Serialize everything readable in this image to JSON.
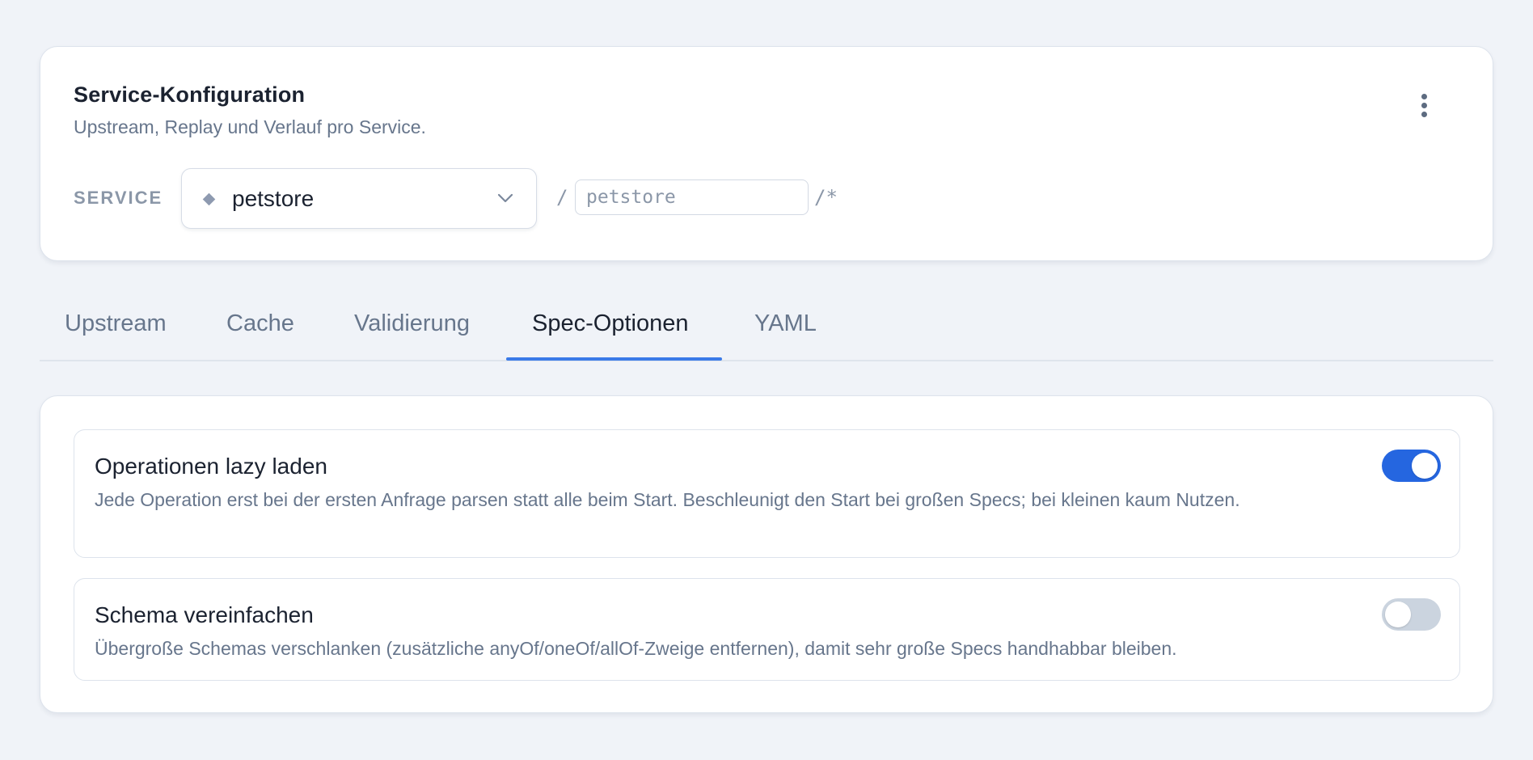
{
  "header": {
    "title": "Service-Konfiguration",
    "subtitle": "Upstream, Replay und Verlauf pro Service.",
    "menu_icon": "more-vertical-icon"
  },
  "service": {
    "label": "SERVICE",
    "selected": "petstore",
    "selected_icon": "diamond-icon",
    "dropdown_icon": "chevron-down-icon",
    "path_prefix": "/",
    "path_placeholder": "petstore",
    "path_suffix": "/*"
  },
  "tabs": [
    {
      "label": "Upstream",
      "active": false
    },
    {
      "label": "Cache",
      "active": false
    },
    {
      "label": "Validierung",
      "active": false
    },
    {
      "label": "Spec-Optionen",
      "active": true
    },
    {
      "label": "YAML",
      "active": false
    }
  ],
  "options": [
    {
      "title": "Operationen lazy laden",
      "description": "Jede Operation erst bei der ersten Anfrage parsen statt alle beim Start. Beschleunigt den Start bei großen Specs; bei kleinen kaum Nutzen.",
      "enabled": true
    },
    {
      "title": "Schema vereinfachen",
      "description": "Übergroße Schemas verschlanken (zusätzliche anyOf/oneOf/allOf-Zweige entfernen), damit sehr große Specs handhabbar bleiben.",
      "enabled": false
    }
  ],
  "colors": {
    "accent": "#2566e0",
    "tab_underline": "#3a7ae8",
    "toggle_off": "#cbd4df",
    "background": "#f0f3f8"
  }
}
